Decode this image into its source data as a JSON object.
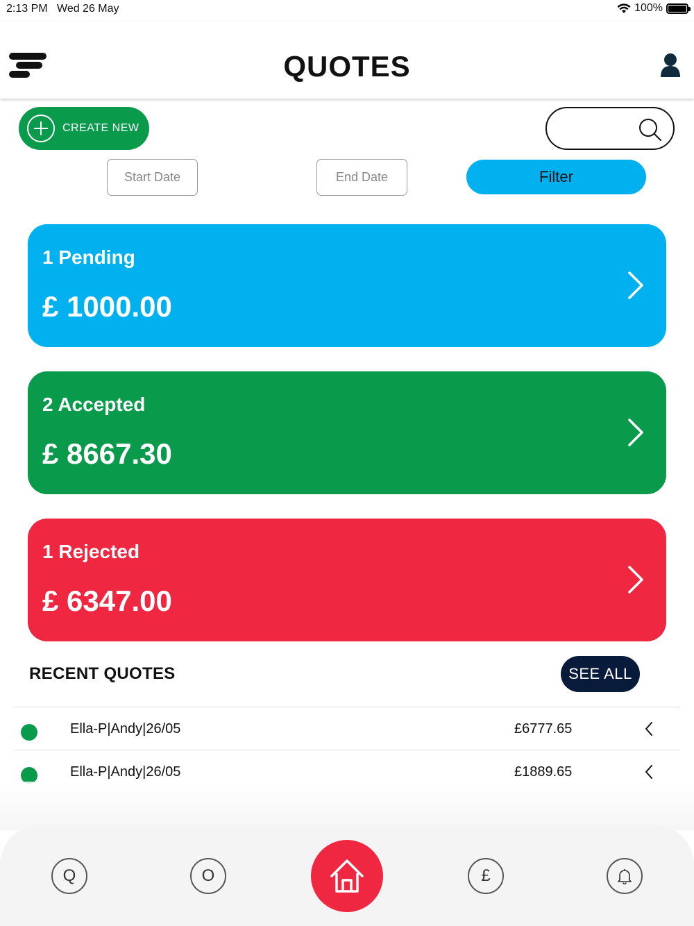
{
  "status_bar": {
    "time": "2:13 PM",
    "date": "Wed 26 May",
    "battery": "100%"
  },
  "header": {
    "title": "QUOTES"
  },
  "toolbar": {
    "create_label": "CREATE NEW",
    "search_value": "",
    "start_date_label": "Start Date",
    "end_date_label": "End Date",
    "filter_label": "Filter"
  },
  "cards": [
    {
      "label": "1 Pending",
      "amount": "£ 1000.00",
      "color": "#00b0ef"
    },
    {
      "label": "2 Accepted",
      "amount": "£ 8667.30",
      "color": "#0a9a4b"
    },
    {
      "label": "1 Rejected",
      "amount": "£ 6347.00",
      "color": "#ef2740"
    }
  ],
  "recent": {
    "title": "RECENT QUOTES",
    "see_all_label": "SEE ALL",
    "items": [
      {
        "name": "Ella-P|Andy|26/05",
        "amount": "£6777.65",
        "status_color": "#0a9a4b"
      },
      {
        "name": "Ella-P|Andy|26/05",
        "amount": "£1889.65",
        "status_color": "#0a9a4b"
      }
    ]
  },
  "bottom_nav": {
    "items": [
      {
        "icon": "q-icon",
        "glyph": "Q"
      },
      {
        "icon": "o-icon",
        "glyph": "O"
      },
      {
        "icon": "home-icon",
        "glyph": ""
      },
      {
        "icon": "pound-icon",
        "glyph": "£"
      },
      {
        "icon": "bell-icon",
        "glyph": ""
      }
    ]
  }
}
